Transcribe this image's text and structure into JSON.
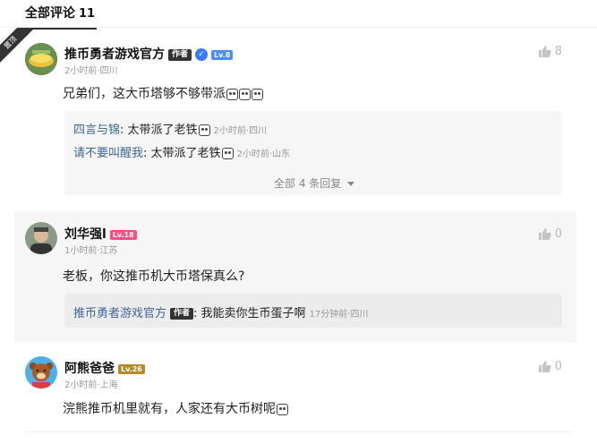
{
  "header": {
    "title": "全部评论",
    "count": "11"
  },
  "pin_label": "置顶",
  "comments": [
    {
      "name": "推币勇者游戏官方",
      "author_badge": "作者",
      "level": "Lv.8",
      "time": "2小时前·四川",
      "text": "兄弟们，这大币塔够不够带派",
      "likes": "8",
      "replies": [
        {
          "name": "四言与锦",
          "text": "太带派了老铁",
          "time": "2小时前·四川"
        },
        {
          "name": "请不要叫醒我",
          "text": "太带派了老铁",
          "time": "2小时前·山东"
        }
      ],
      "more": "全部 4 条回复"
    },
    {
      "name": "刘华强l",
      "level": "Lv.18",
      "time": "1小时前·江苏",
      "text": "老板，你这推币机大币塔保真么?",
      "likes": "0",
      "replies": [
        {
          "name": "推币勇者游戏官方",
          "badge": "作者",
          "text": "我能卖你生币蛋子啊",
          "time": "17分钟前·四川"
        }
      ]
    },
    {
      "name": "阿熊爸爸",
      "level": "Lv.26",
      "time": "2小时前·上海",
      "text": "浣熊推币机里就有，人家还有大币树呢",
      "likes": "0"
    }
  ],
  "colors": {
    "lv8": "#4a8cff",
    "lv18": "#ff4d7e",
    "lv26": "#b58a2a",
    "reply_name": "#406599"
  }
}
